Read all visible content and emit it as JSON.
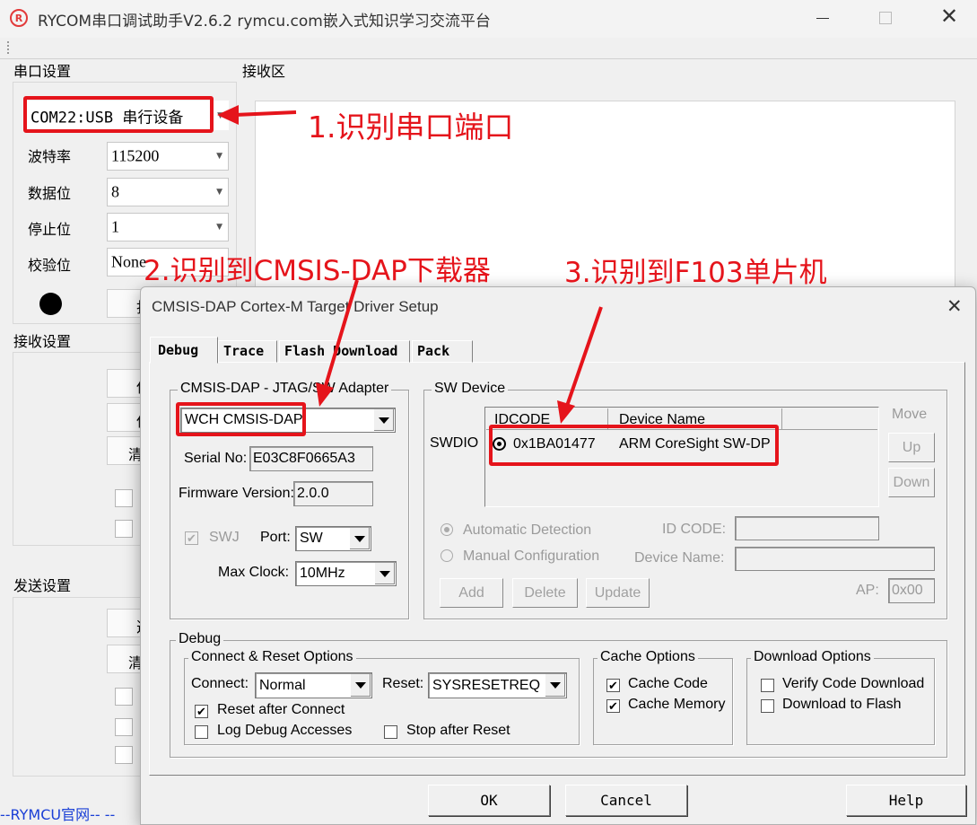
{
  "app": {
    "title": "RYCOM串口调试助手V2.6.2 rymcu.com嵌入式知识学习交流平台",
    "icon": "rycom-logo-icon",
    "footer_link": "--RYMCU官网--  --",
    "serial": {
      "section": "串口设置",
      "port": "COM22:USB 串行设备",
      "baud_label": "波特率",
      "baud": "115200",
      "data_label": "数据位",
      "data": "8",
      "stop_label": "停止位",
      "stop": "1",
      "parity_label": "校验位",
      "parity": "None",
      "open_btn": "打"
    },
    "receive": {
      "section": "接收设置",
      "btn1": "保",
      "btn2": "保",
      "btn3": "清"
    },
    "send": {
      "section": "发送设置",
      "btn1": "选",
      "btn2": "清"
    },
    "recv_area": "接收区"
  },
  "dialog": {
    "title": "CMSIS-DAP Cortex-M Target Driver Setup",
    "tabs": [
      "Debug",
      "Trace",
      "Flash Download",
      "Pack"
    ],
    "adapter": {
      "title": "CMSIS-DAP - JTAG/SW Adapter",
      "selected": "WCH CMSIS-DAP",
      "serial_label": "Serial No:",
      "serial": "E03C8F0665A3",
      "fw_label": "Firmware Version:",
      "fw": "2.0.0",
      "swj_label": "SWJ",
      "port_label": "Port:",
      "port": "SW",
      "clock_label": "Max Clock:",
      "clock": "10MHz"
    },
    "swdevice": {
      "title": "SW Device",
      "swdio": "SWDIO",
      "col_idcode": "IDCODE",
      "col_name": "Device Name",
      "row": {
        "idcode": "0x1BA01477",
        "name": "ARM CoreSight SW-DP"
      },
      "move": "Move",
      "up": "Up",
      "down": "Down",
      "auto": "Automatic Detection",
      "manual": "Manual Configuration",
      "idcode_label": "ID CODE:",
      "devname_label": "Device Name:",
      "add": "Add",
      "delete": "Delete",
      "update": "Update",
      "ap_label": "AP:",
      "ap": "0x00"
    },
    "debug": {
      "title": "Debug",
      "connect_group": "Connect & Reset Options",
      "connect_label": "Connect:",
      "connect": "Normal",
      "reset_label": "Reset:",
      "reset": "SYSRESETREQ",
      "reset_after_connect": "Reset after Connect",
      "log_debug": "Log Debug Accesses",
      "stop_after_reset": "Stop after Reset",
      "cache_group": "Cache Options",
      "cache_code": "Cache Code",
      "cache_memory": "Cache Memory",
      "download_group": "Download Options",
      "verify": "Verify Code Download",
      "download_flash": "Download to Flash"
    },
    "buttons": {
      "ok": "OK",
      "cancel": "Cancel",
      "help": "Help"
    }
  },
  "annotations": {
    "a1": "1.识别串口端口",
    "a2": "2.识别到CMSIS-DAP下载器",
    "a3": "3.识别到F103单片机"
  },
  "colors": {
    "accent_red": "#e5141b"
  }
}
